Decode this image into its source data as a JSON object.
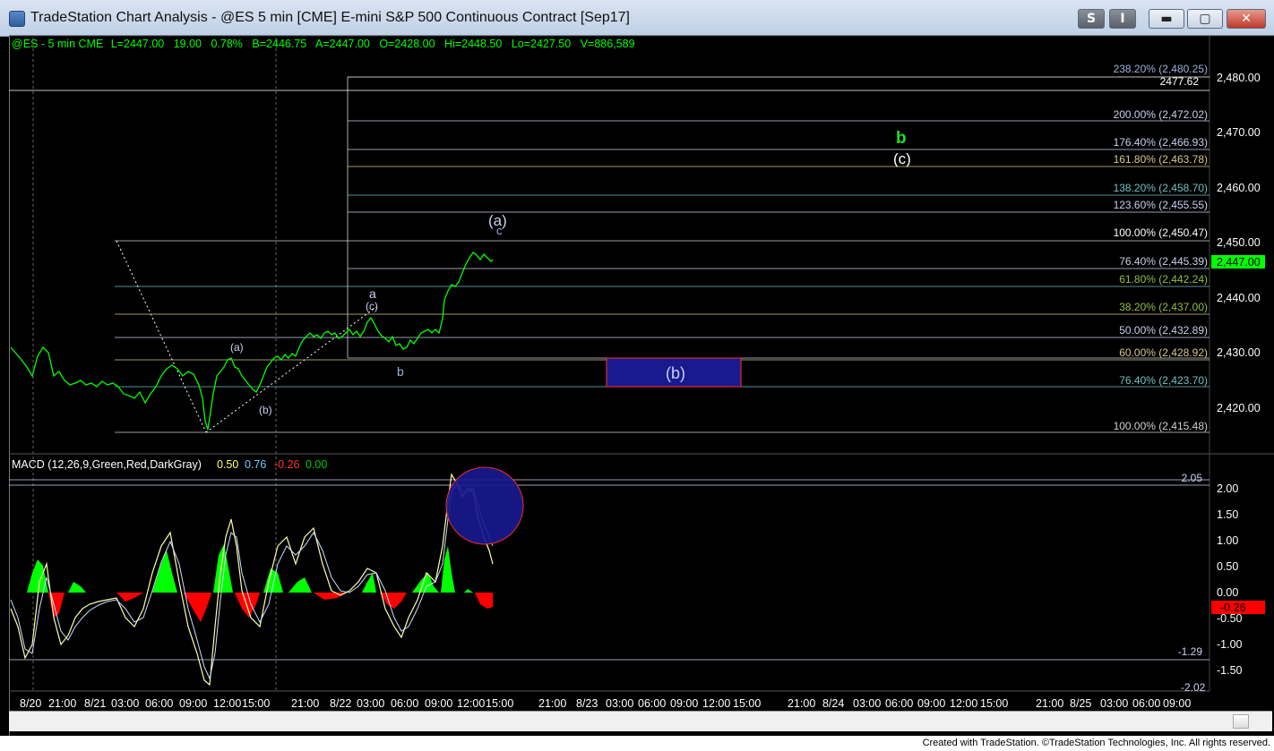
{
  "window": {
    "title": "TradeStation Chart Analysis - @ES 5 min [CME] E-mini S&P 500 Continuous Contract [Sep17]",
    "buttons": {
      "style": "S",
      "indicator": "I",
      "minimize": "▬",
      "maximize": "▢",
      "close": "✕"
    }
  },
  "status_line": {
    "symbol": "@ES - 5 min  CME",
    "last": "L=2447.00",
    "change": "19.00",
    "pct": "0.78%",
    "bid": "B=2446.75",
    "ask": "A=2447.00",
    "open": "O=2428.00",
    "high": "Hi=2448.50",
    "low": "Lo=2427.50",
    "volume": "V=886,589"
  },
  "price_axis": {
    "ticks": [
      "2,480.00",
      "2,470.00",
      "2,460.00",
      "2,450.00",
      "2,440.00",
      "2,430.00",
      "2,420.00"
    ],
    "last_price": "2,447.00"
  },
  "fib_labels": [
    "238.20% (2,480.25)",
    "2477.62",
    "200.00% (2,472.02)",
    "176.40% (2,466.93)",
    "161.80% (2,463.78)",
    "138.20% (2,458.70)",
    "123.60% (2,455.55)",
    "100.00% (2,450.47)",
    "76.40% (2,445.39)",
    "61.80% (2,442.24)",
    "38.20% (2,437.00)",
    "50.00% (2,432.89)",
    "60.00% (2,428.92)",
    "76.40% (2,423.70)",
    "100.00% (2,415.48)"
  ],
  "wave_labels": {
    "b_green": "b",
    "c_paren_top": "(c)",
    "a_paren": "(a)",
    "c_small": "c",
    "a_small": "a",
    "c_paren_small": "(c)",
    "b_small": "b",
    "a_paren_left": "(a)",
    "b_paren_left": "(b)",
    "b_box": "(b)"
  },
  "macd": {
    "label": "MACD (12,26,9,Green,Red,DarkGray)",
    "v1": "0.50",
    "v2": "0.76",
    "v3": "-0.26",
    "v4": "0.00",
    "ticks": [
      "2.00",
      "1.50",
      "1.00",
      "0.50",
      "0.00",
      "-0.50",
      "-1.00",
      "-1.50"
    ],
    "line_top": "2.05",
    "line_bottom": "-1.29",
    "current": "-0.26",
    "clipped": "-2.02"
  },
  "time_axis": [
    "8/20",
    "21:00",
    "8/21",
    "03:00",
    "06:00",
    "09:00",
    "12:00",
    "15:00",
    "21:00",
    "8/22",
    "03:00",
    "06:00",
    "09:00",
    "12:00",
    "15:00",
    "21:00",
    "8/23",
    "03:00",
    "06:00",
    "09:00",
    "12:00",
    "15:00",
    "21:00",
    "8/24",
    "03:00",
    "06:00",
    "09:00",
    "12:00",
    "15:00",
    "21:00",
    "8/25",
    "03:00",
    "06:00",
    "09:00"
  ],
  "footer": "Created with TradeStation. ©TradeStation Technologies, Inc. All rights reserved.",
  "colors": {
    "price": "#00ff00",
    "fib": "#9fb0d8",
    "macd_pos": "#00ff00",
    "macd_neg": "#ff0000",
    "box": "#1a1a8f",
    "last_tag": "#00ff00",
    "neg_tag": "#ff0000"
  }
}
